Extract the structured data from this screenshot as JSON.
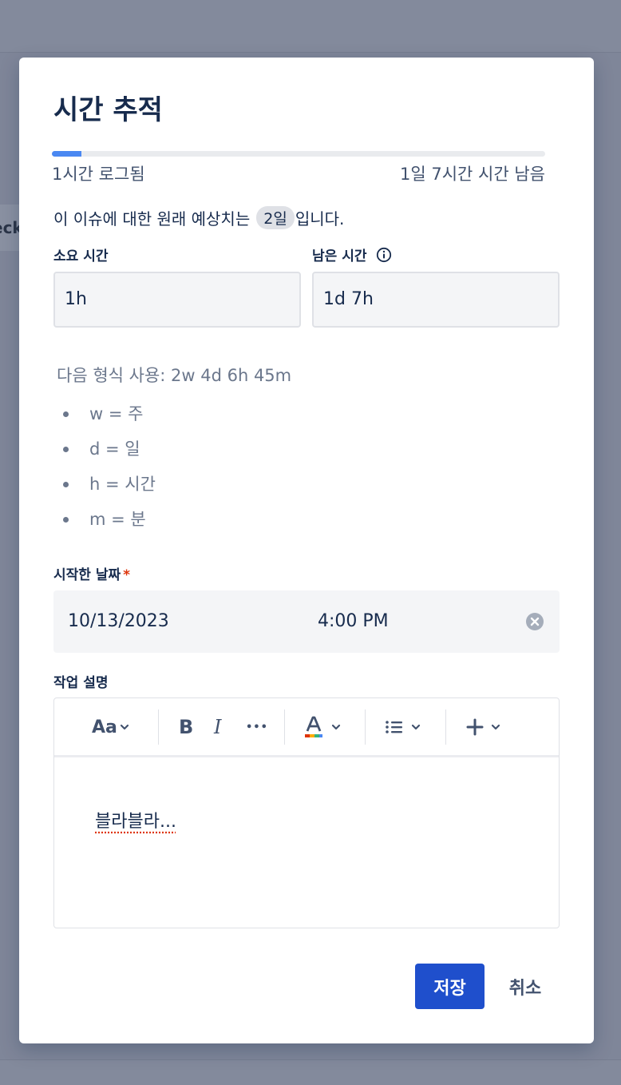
{
  "backdrop": {
    "peek_text": "eck"
  },
  "modal": {
    "title": "시간 추적",
    "progress": {
      "logged_fraction": 0.06,
      "logged_label": "1시간 로그됨",
      "remaining_label": "1일 7시간 시간 남음"
    },
    "estimate": {
      "prefix": "이 이슈에 대한 원래 예상치는",
      "badge": "2일",
      "suffix": "입니다."
    },
    "time_spent": {
      "label": "소요 시간",
      "value": "1h"
    },
    "time_remaining": {
      "label": "남은 시간",
      "value": "1d 7h"
    },
    "format_hint": "다음 형식 사용: 2w 4d 6h 45m",
    "format_items": [
      "w = 주",
      "d = 일",
      "h = 시간",
      "m = 분"
    ],
    "start_date": {
      "label": "시작한 날짜",
      "required_mark": "*",
      "date": "10/13/2023",
      "time": "4:00 PM"
    },
    "description": {
      "label": "작업 설명",
      "toolbar": {
        "text_style_label": "Aa",
        "bold_label": "B",
        "italic_label": "I",
        "more_label": "•••"
      },
      "content": "블라블라..."
    },
    "buttons": {
      "save": "저장",
      "cancel": "취소"
    }
  },
  "colors": {
    "primary": "#1f4fcc",
    "progress": "#4a88f2",
    "required": "#de350b",
    "text": "#172b4d",
    "muted": "#6b778c"
  }
}
